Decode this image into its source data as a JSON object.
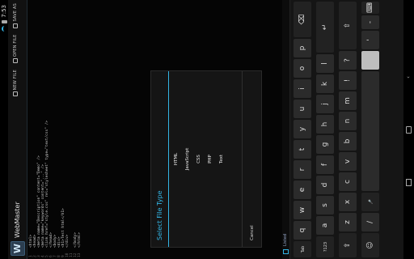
{
  "status": {
    "time": "7:53"
  },
  "app": {
    "logo": "W",
    "title": "WebMaster",
    "actions": [
      {
        "label": "NEW FILE",
        "icon": "new-file-icon"
      },
      {
        "label": "OPEN FILE",
        "icon": "open-file-icon"
      },
      {
        "label": "SAVE AS",
        "icon": "save-as-icon"
      }
    ]
  },
  "editor": {
    "line_numbers": [
      "1",
      "2",
      "3",
      "4",
      "5",
      "6",
      "7",
      "8",
      "9",
      "10",
      "11",
      "12",
      "13"
    ],
    "lines": [
      "<html>",
      "<head>",
      "<meta name=\"Description\" content=\"Demo\" />",
      "<meta name=\"keywords\" content=\"...\" />",
      "<link href=\"style.css\" rel=\"stylesheet\" type=\"text/css\" />",
      "</head>",
      "<body>",
      "<div>",
      "<h1>Test html</h1>",
      "</div>",
      "",
      "</body>",
      "</html>"
    ]
  },
  "dialog": {
    "title": "Select File Type",
    "options": [
      "HTML",
      "JavaScript",
      "CSS",
      "PHP",
      "Text"
    ],
    "cancel_label": "Cancel"
  },
  "keyboard": {
    "suggestion": "Listed",
    "row1": [
      "Tab",
      "q",
      "w",
      "e",
      "r",
      "t",
      "y",
      "u",
      "i",
      "o",
      "p",
      "⌫"
    ],
    "row2": [
      "?123",
      "a",
      "s",
      "d",
      "f",
      "g",
      "h",
      "j",
      "k",
      "l",
      "↵"
    ],
    "row3": [
      "⇧",
      "z",
      "x",
      "c",
      "v",
      "b",
      "n",
      "m",
      "!",
      "?",
      "⇧"
    ],
    "row4": [
      "☺",
      "/",
      "🎤",
      "",
      "",
      "'",
      "-",
      "⌨"
    ],
    "colors": {
      "accent": "#33b5e5",
      "key": "#2b2b2b",
      "key_light": "#bdbdbd"
    }
  }
}
